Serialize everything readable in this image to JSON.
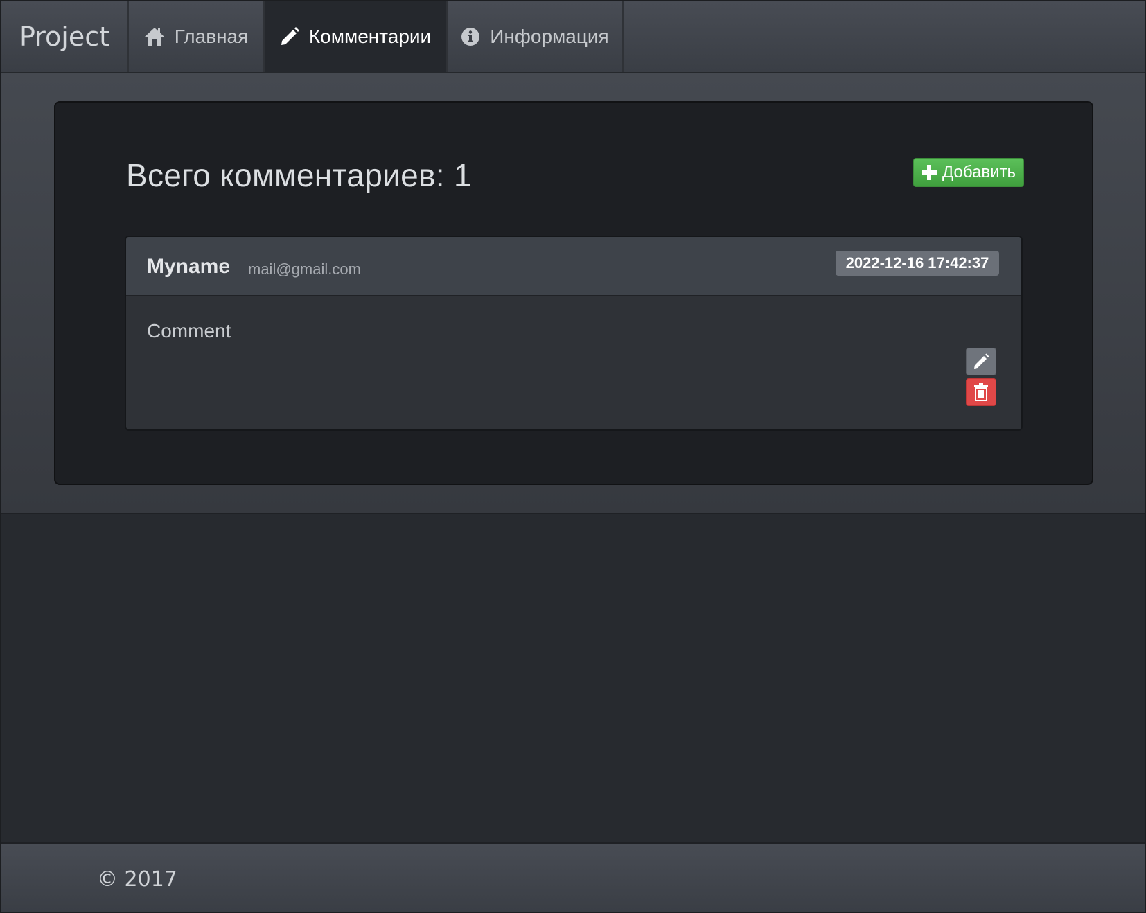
{
  "navbar": {
    "brand": "Project",
    "items": [
      {
        "label": "Главная",
        "icon": "home-icon",
        "active": false
      },
      {
        "label": "Комментарии",
        "icon": "pencil-icon",
        "active": true
      },
      {
        "label": "Информация",
        "icon": "info-icon",
        "active": false
      }
    ]
  },
  "main": {
    "title": "Всего комментариев: 1",
    "add_button_label": "Добавить",
    "comments": [
      {
        "author": "Myname",
        "email": "mail@gmail.com",
        "date": "2022-12-16 17:42:37",
        "text": "Comment"
      }
    ]
  },
  "footer": {
    "copyright": "© 2017"
  },
  "colors": {
    "accent_green": "#4cae4a",
    "danger_red": "#e04848",
    "badge_gray": "#6b7078"
  }
}
